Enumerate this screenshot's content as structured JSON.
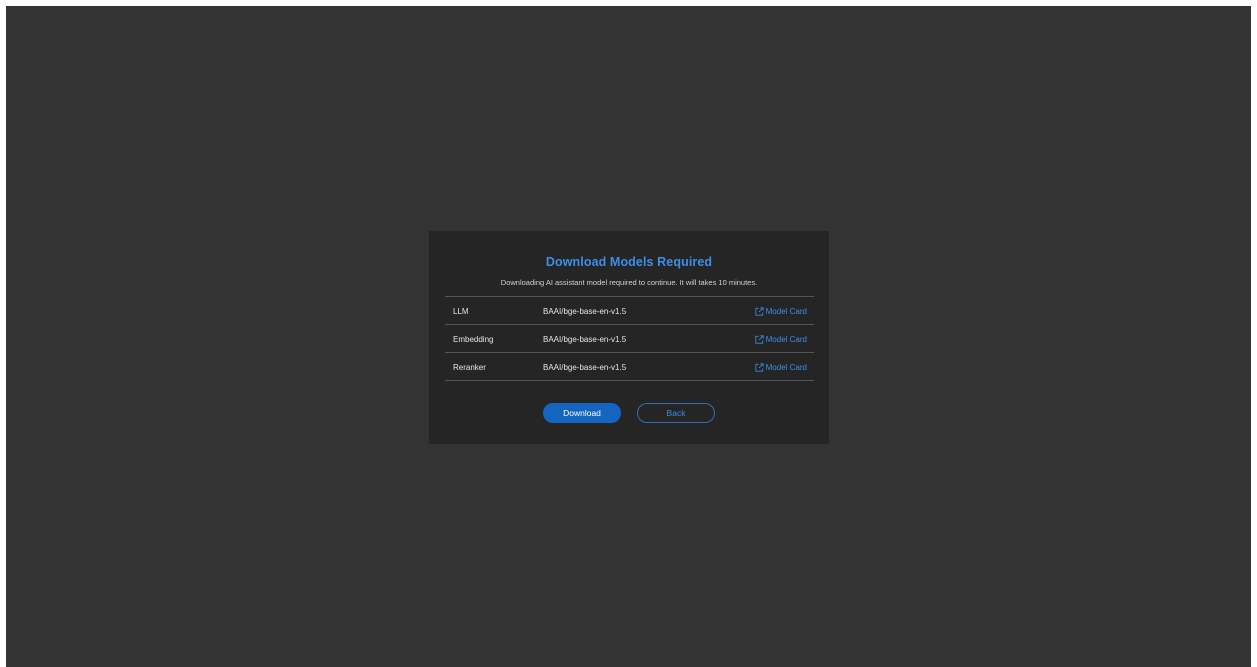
{
  "dialog": {
    "title": "Download Models Required",
    "subtitle": "Downloading AI assistant model required to continue. It will takes 10 minutes.",
    "models": [
      {
        "type": "LLM",
        "model": "BAAI/bge-base-en-v1.5",
        "link_label": "Model Card",
        "link_icon": "external-link-icon"
      },
      {
        "type": "Embedding",
        "model": "BAAI/bge-base-en-v1.5",
        "link_label": "Model Card",
        "link_icon": "external-link-icon"
      },
      {
        "type": "Reranker",
        "model": "BAAI/bge-base-en-v1.5",
        "link_label": "Model Card",
        "link_icon": "external-link-icon"
      }
    ],
    "download_label": "Download",
    "back_label": "Back"
  },
  "colors": {
    "background": "#333333",
    "dialog_background": "#252525",
    "accent": "#3c8ee6",
    "primary_button": "#1565c0",
    "divider": "#555555"
  }
}
